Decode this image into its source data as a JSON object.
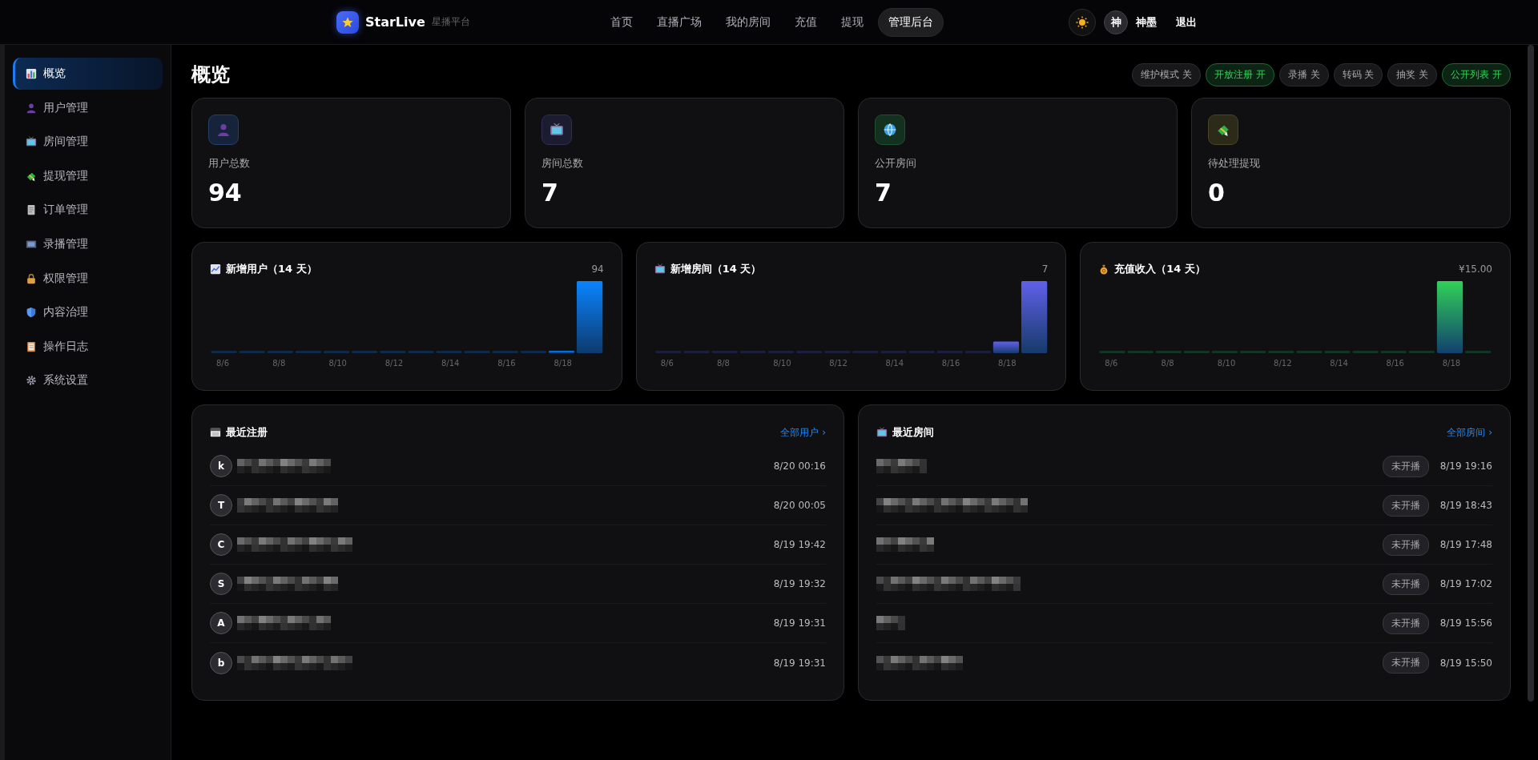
{
  "topbar": {
    "brand": "StarLive",
    "subtitle": "星播平台",
    "nav": [
      {
        "label": "首页",
        "selected": false
      },
      {
        "label": "直播广场",
        "selected": false
      },
      {
        "label": "我的房间",
        "selected": false
      },
      {
        "label": "充值",
        "selected": false
      },
      {
        "label": "提现",
        "selected": false
      },
      {
        "label": "管理后台",
        "selected": true
      }
    ],
    "user": {
      "avatar": "神",
      "name": "神墨"
    },
    "logout": "退出"
  },
  "sidebar": {
    "items": [
      {
        "label": "概览",
        "selected": true
      },
      {
        "label": "用户管理",
        "selected": false
      },
      {
        "label": "房间管理",
        "selected": false
      },
      {
        "label": "提现管理",
        "selected": false
      },
      {
        "label": "订单管理",
        "selected": false
      },
      {
        "label": "录播管理",
        "selected": false
      },
      {
        "label": "权限管理",
        "selected": false
      },
      {
        "label": "内容治理",
        "selected": false
      },
      {
        "label": "操作日志",
        "selected": false
      },
      {
        "label": "系统设置",
        "selected": false
      }
    ]
  },
  "page_title": "概览",
  "toggles": [
    {
      "label": "维护模式 关",
      "on": false
    },
    {
      "label": "开放注册 开",
      "on": true
    },
    {
      "label": "录播 关",
      "on": false
    },
    {
      "label": "转码 关",
      "on": false
    },
    {
      "label": "抽奖 关",
      "on": false
    },
    {
      "label": "公开列表 开",
      "on": true
    }
  ],
  "stats": [
    {
      "label": "用户总数",
      "value": "94"
    },
    {
      "label": "房间总数",
      "value": "7"
    },
    {
      "label": "公开房间",
      "value": "7"
    },
    {
      "label": "待处理提现",
      "value": "0"
    }
  ],
  "trend_cards": [
    {
      "title": "新增用户（14 天）",
      "total": "94",
      "xlabels": [
        "8/6",
        "8/8",
        "8/10",
        "8/12",
        "8/14",
        "8/16",
        "8/18"
      ]
    },
    {
      "title": "新增房间（14 天）",
      "total": "7",
      "xlabels": [
        "8/6",
        "8/8",
        "8/10",
        "8/12",
        "8/14",
        "8/16",
        "8/18"
      ]
    },
    {
      "title": "充值收入（14 天）",
      "total": "¥15.00",
      "xlabels": [
        "8/6",
        "8/8",
        "8/10",
        "8/12",
        "8/14",
        "8/16",
        "8/18"
      ]
    }
  ],
  "recent_users": {
    "title": "最近注册",
    "link": "全部用户 ›",
    "rows": [
      {
        "initial": "k",
        "time": "8/20 00:16"
      },
      {
        "initial": "T",
        "time": "8/20 00:05"
      },
      {
        "initial": "C",
        "time": "8/19 19:42"
      },
      {
        "initial": "S",
        "time": "8/19 19:32"
      },
      {
        "initial": "A",
        "time": "8/19 19:31"
      },
      {
        "initial": "b",
        "time": "8/19 19:31"
      }
    ]
  },
  "recent_rooms": {
    "title": "最近房间",
    "link": "全部房间 ›",
    "rows": [
      {
        "status": "未开播",
        "time": "8/19 19:16"
      },
      {
        "status": "未开播",
        "time": "8/19 18:43"
      },
      {
        "status": "未开播",
        "time": "8/19 17:48"
      },
      {
        "status": "未开播",
        "time": "8/19 17:02"
      },
      {
        "status": "未开播",
        "time": "8/19 15:56"
      },
      {
        "status": "未开播",
        "time": "8/19 15:50"
      }
    ]
  }
}
